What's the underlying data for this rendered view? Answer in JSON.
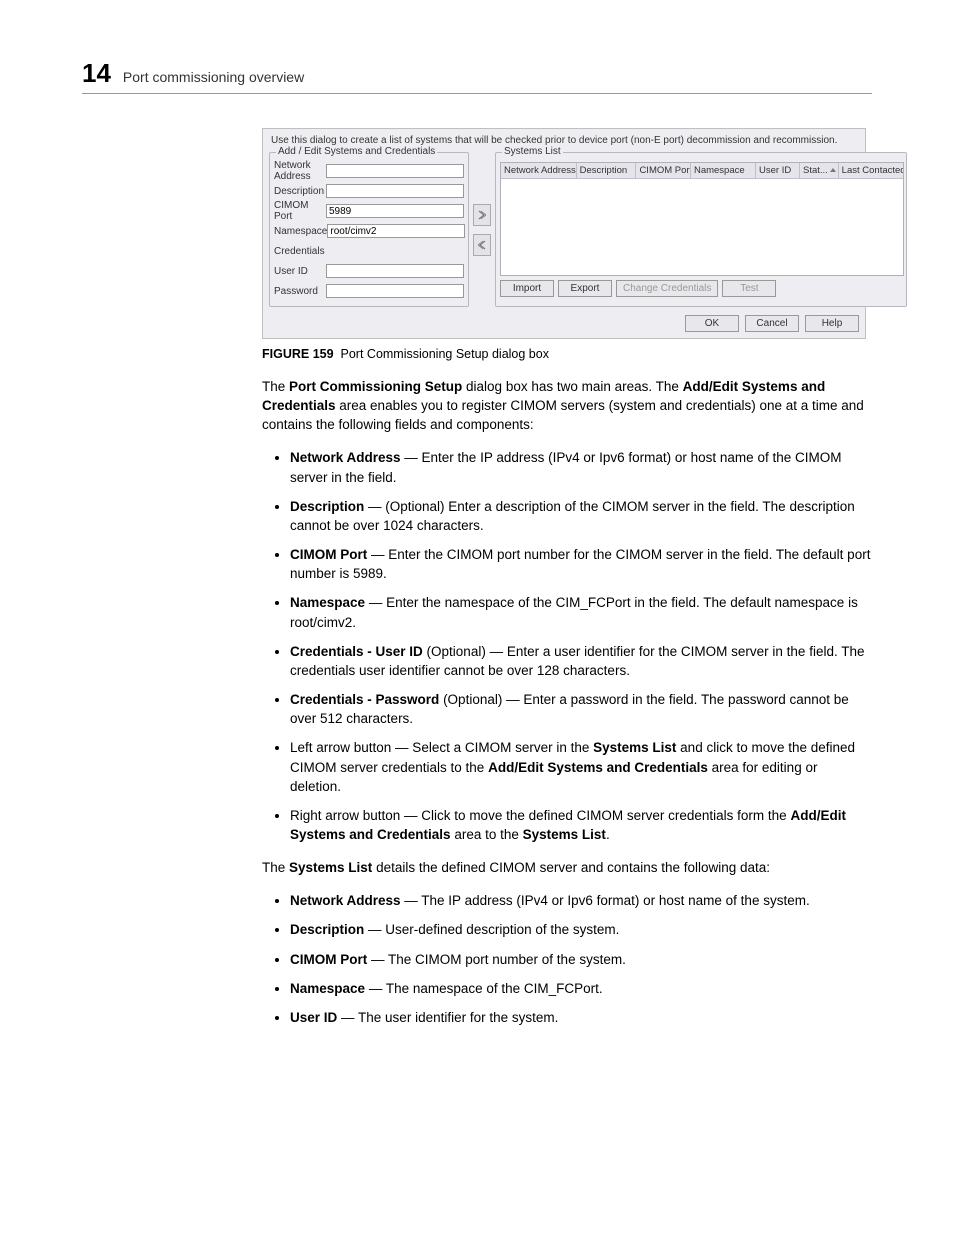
{
  "header": {
    "page_number": "14",
    "section_title": "Port commissioning overview"
  },
  "dialog": {
    "instruction": "Use this dialog to create a list of systems that will be checked prior to device port (non-E port) decommission and recommission.",
    "left_panel_title": "Add / Edit Systems and Credentials",
    "fields": {
      "network_address": {
        "label": "Network Address",
        "value": ""
      },
      "description": {
        "label": "Description",
        "value": ""
      },
      "cimom_port": {
        "label": "CIMOM Port",
        "value": "5989"
      },
      "namespace": {
        "label": "Namespace",
        "value": "root/cimv2"
      },
      "credentials_hdr": "Credentials",
      "user_id": {
        "label": "User ID",
        "value": ""
      },
      "password": {
        "label": "Password",
        "value": ""
      }
    },
    "right_panel_title": "Systems List",
    "columns": {
      "addr": "Network Address",
      "desc": "Description",
      "port": "CIMOM Port",
      "ns": "Namespace",
      "uid": "User ID",
      "stat": "Stat...",
      "last": "Last Contacted"
    },
    "buttons": {
      "import": "Import",
      "export": "Export",
      "change_cred": "Change Credentials",
      "test": "Test",
      "ok": "OK",
      "cancel": "Cancel",
      "help": "Help"
    }
  },
  "figure": {
    "label": "FIGURE 159",
    "caption": "Port Commissioning Setup dialog box"
  },
  "para1": {
    "t1": "The ",
    "b1": "Port Commissioning Setup",
    "t2": " dialog box has two main areas. The ",
    "b2": "Add/Edit Systems and Credentials",
    "t3": " area enables you to register CIMOM servers (system and credentials) one at a time and contains the following fields and components:"
  },
  "list1": [
    {
      "b": "Network Address",
      "t": " — Enter the IP address (IPv4 or Ipv6 format) or host name of the CIMOM server in the field."
    },
    {
      "b": "Description",
      "t": " — (Optional) Enter a description of the CIMOM server in the field. The description cannot be over 1024 characters."
    },
    {
      "b": "CIMOM Port",
      "t": " — Enter the CIMOM port number for the CIMOM server in the field. The default port number is 5989."
    },
    {
      "b": "Namespace",
      "t": " — Enter the namespace of the CIM_FCPort in the field. The default namespace is root/cimv2."
    },
    {
      "b": "Credentials - User ID",
      "t": " (Optional) — Enter a user identifier for the CIMOM server in the field. The credentials user identifier cannot be over 128 characters."
    },
    {
      "b": "Credentials - Password",
      "t": " (Optional) — Enter a password in the field. The password cannot be over 512 characters."
    },
    {
      "pre": "Left arrow button — Select a CIMOM server in the ",
      "b": "Systems List",
      "mid": " and click to move the defined CIMOM server credentials to the ",
      "b2": "Add/Edit Systems and Credentials",
      "post": " area for editing or deletion."
    },
    {
      "pre": "Right arrow button — Click to move the defined CIMOM server credentials form the ",
      "b": "Add/Edit Systems and Credentials",
      "mid": " area to the ",
      "b2": "Systems List",
      "post": "."
    }
  ],
  "para2": {
    "t1": "The ",
    "b1": "Systems List",
    "t2": " details the defined CIMOM server and contains the following data:"
  },
  "list2": [
    {
      "b": "Network Address",
      "t": " — The IP address (IPv4 or Ipv6 format) or host name of the system."
    },
    {
      "b": "Description",
      "t": " — User-defined description of the system."
    },
    {
      "b": "CIMOM Port",
      "t": " — The CIMOM port number of the system."
    },
    {
      "b": "Namespace",
      "t": " — The namespace of the CIM_FCPort."
    },
    {
      "b": "User ID",
      "t": " — The user identifier for the system."
    }
  ]
}
